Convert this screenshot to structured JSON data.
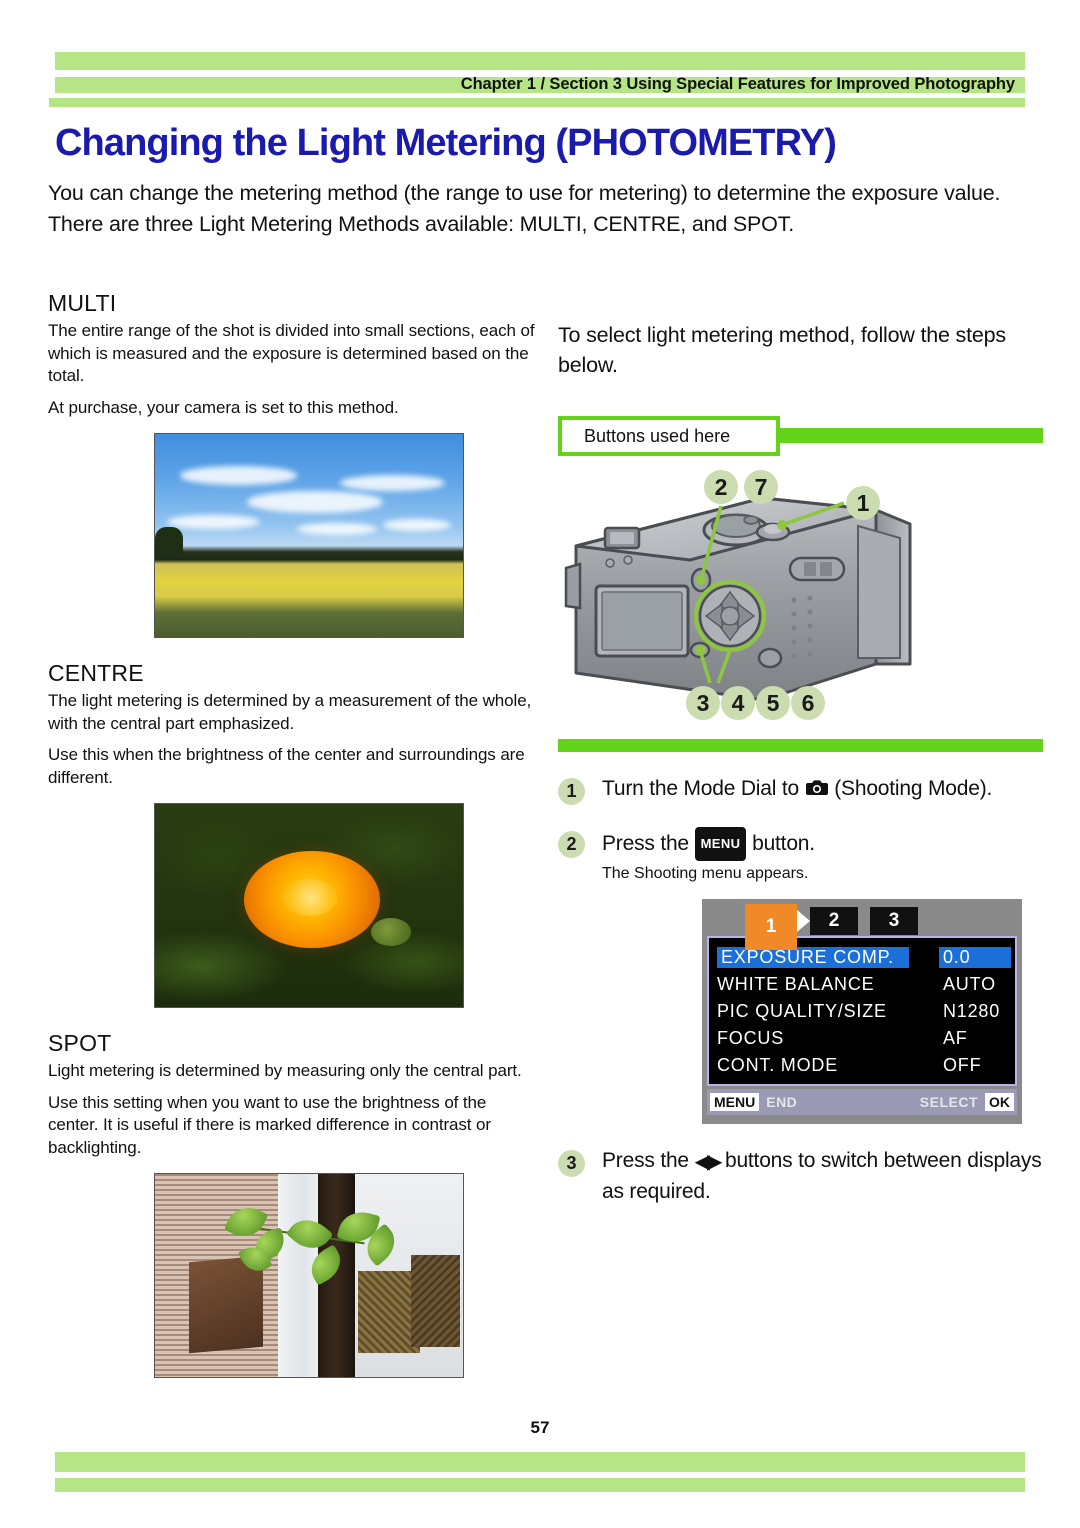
{
  "header": {
    "breadcrumb": "Chapter 1 / Section 3  Using Special Features for Improved Photography"
  },
  "title": "Changing the Light Metering (PHOTOMETRY)",
  "intro": "You can change the metering method (the range to use for metering) to determine the exposure value. There are three Light Metering Methods available: MULTI, CENTRE, and SPOT.",
  "sections": [
    {
      "heading": "MULTI",
      "paragraphs": [
        "The entire range of the shot is divided into small sections, each of which is measured and the exposure is determined based on the total.",
        "At purchase, your camera is set to this method."
      ],
      "photo_alt": "Sunflower field landscape under blue sky"
    },
    {
      "heading": "CENTRE",
      "paragraphs": [
        "The light metering is determined by a measurement of the whole, with the central part emphasized.",
        "Use this when the brightness of the center and surroundings are different."
      ],
      "photo_alt": "Orange marigold flower close-up"
    },
    {
      "heading": "SPOT",
      "paragraphs": [
        "Light metering is determined by measuring only the central part.",
        "Use this setting when you want to use the brightness of the center. It is useful if there is marked difference in contrast or backlighting."
      ],
      "photo_alt": "Backlit window with bamboo blind, plant and hanging baskets"
    }
  ],
  "right": {
    "lead": "To select light metering method, follow the steps below.",
    "buttons_banner": "Buttons used here",
    "camera_callouts": [
      "2",
      "7",
      "1",
      "3",
      "4",
      "5",
      "6"
    ],
    "steps": [
      {
        "num": "1",
        "text_before": "Turn the Mode Dial to",
        "icon": "camera-icon",
        "text_after": "(Shooting Mode).",
        "sub": ""
      },
      {
        "num": "2",
        "text_before": "Press the",
        "key": "MENU",
        "text_after": "button.",
        "sub": "The Shooting menu appears."
      },
      {
        "num": "3",
        "text_before": "Press the",
        "icon": "left-right-arrows-icon",
        "text_after": "buttons to switch between displays as required.",
        "sub": ""
      }
    ]
  },
  "lcd": {
    "tabs": [
      "1",
      "2",
      "3"
    ],
    "active_tab": "1",
    "rows": [
      {
        "label": "EXPOSURE COMP.",
        "value": "0.0",
        "selected": true
      },
      {
        "label": "WHITE BALANCE",
        "value": "AUTO",
        "selected": false
      },
      {
        "label": "PIC QUALITY/SIZE",
        "value": "N1280",
        "selected": false
      },
      {
        "label": "FOCUS",
        "value": "AF",
        "selected": false
      },
      {
        "label": "CONT. MODE",
        "value": "OFF",
        "selected": false
      }
    ],
    "footer": {
      "left_key": "MENU",
      "left_label": "END",
      "right_label": "SELECT",
      "right_key": "OK"
    }
  },
  "footer": {
    "page_number": "57"
  },
  "colors": {
    "bar_green": "#b5e585",
    "accent_green": "#63d41a",
    "badge_green": "#cadcb0",
    "title_blue": "#1a1aad",
    "lcd_highlight": "#1b6fd8",
    "lcd_tab_active": "#f08a28"
  }
}
